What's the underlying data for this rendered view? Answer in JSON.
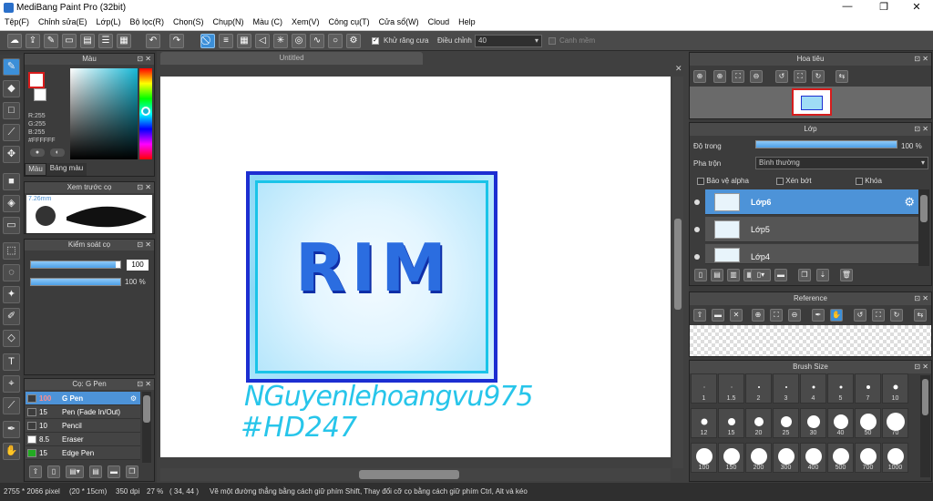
{
  "window": {
    "title": "MediBang Paint Pro (32bit)",
    "minimize": "—",
    "restore": "❐",
    "close": "✕"
  },
  "menu": [
    "Tệp(F)",
    "Chỉnh sửa(E)",
    "Lớp(L)",
    "Bộ lọc(R)",
    "Chọn(S)",
    "Chụp(N)",
    "Màu (C)",
    "Xem(V)",
    "Công cụ(T)",
    "Cửa sổ(W)",
    "Cloud",
    "Help"
  ],
  "toolbar": {
    "antialias_label": "Khử răng cưa",
    "antialias_checked": true,
    "correction_label": "Điều chỉnh",
    "correction_value": "40",
    "snap_label": "Canh mềm",
    "snap_checked": false
  },
  "color_panel": {
    "title": "Màu",
    "r": "R:255",
    "g": "G:255",
    "b": "B:255",
    "hex": "#FFFFFF",
    "tab_color": "Màu",
    "tab_palette": "Bảng màu",
    "primary_color": "#d81c1c",
    "secondary_color": "#ffffff"
  },
  "brush_preview": {
    "title": "Xem trước cọ",
    "size": "7.26mm"
  },
  "brush_control": {
    "title": "Kiểm soát cọ",
    "size_value": "100",
    "opacity_value": "100 %",
    "size_fraction": 0.95,
    "opacity_fraction": 1.0
  },
  "brush_list": {
    "title": "Cọ: G Pen",
    "items": [
      {
        "size": "100",
        "name": "G Pen",
        "color": "#3c3c3c",
        "selected": true
      },
      {
        "size": "15",
        "name": "Pen (Fade In/Out)",
        "color": "#3c3c3c"
      },
      {
        "size": "10",
        "name": "Pencil",
        "color": "#3c3c3c"
      },
      {
        "size": "8.5",
        "name": "Eraser",
        "color": "#ffffff"
      },
      {
        "size": "15",
        "name": "Edge Pen",
        "color": "#22aa22"
      }
    ]
  },
  "canvas": {
    "tab": "Untitled",
    "artwork_text": "RIM",
    "handwriting_1": "NGuyenlehoangvu975",
    "handwriting_2": "#HD247"
  },
  "navigator": {
    "title": "Hoa tiêu"
  },
  "layers": {
    "title": "Lớp",
    "opacity_label": "Độ trong",
    "opacity_value": "100 %",
    "opacity_fraction": 1.0,
    "blend_label": "Pha trộn",
    "blend_value": "Bình thường",
    "protect_alpha": "Bảo vệ alpha",
    "clipping": "Xén bớt",
    "lock": "Khóa",
    "items": [
      {
        "name": "Lớp6",
        "selected": true
      },
      {
        "name": "Lớp5"
      },
      {
        "name": "Lớp4"
      }
    ]
  },
  "reference": {
    "title": "Reference"
  },
  "brush_size": {
    "title": "Brush Size",
    "sizes": [
      "1",
      "1.5",
      "2",
      "3",
      "4",
      "5",
      "7",
      "10",
      "12",
      "15",
      "20",
      "25",
      "30",
      "40",
      "50",
      "70",
      "100",
      "150",
      "200",
      "300",
      "400",
      "500",
      "700",
      "1000"
    ]
  },
  "status": {
    "dimensions": "2755 * 2066 pixel",
    "physical": "(20 * 15cm)",
    "dpi": "350 dpi",
    "zoom": "27 %",
    "cursor": "( 34, 44 )",
    "hint": "Vẽ một đường thẳng bằng cách giữ phím Shift, Thay đổi cỡ cọ bằng cách giữ phím Ctrl, Alt và kéo"
  }
}
